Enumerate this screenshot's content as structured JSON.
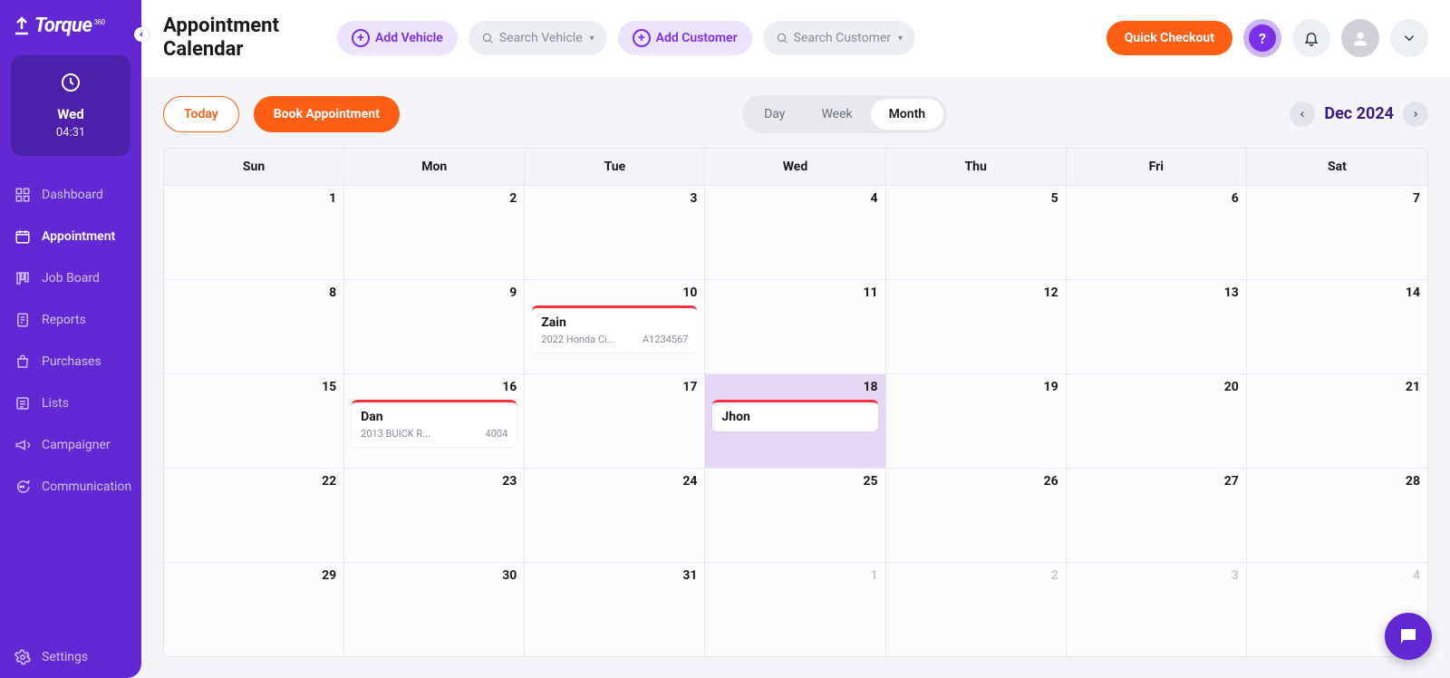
{
  "brand": {
    "name": "Torque",
    "sup": "360"
  },
  "clock": {
    "day": "Wed",
    "time": "04:31"
  },
  "sidebar": {
    "items": [
      {
        "label": "Dashboard"
      },
      {
        "label": "Appointment"
      },
      {
        "label": "Job Board"
      },
      {
        "label": "Reports"
      },
      {
        "label": "Purchases"
      },
      {
        "label": "Lists"
      },
      {
        "label": "Campaigner"
      },
      {
        "label": "Communication"
      }
    ],
    "settings_label": "Settings"
  },
  "header": {
    "title_line1": "Appointment",
    "title_line2": "Calendar",
    "add_vehicle": "Add Vehicle",
    "search_vehicle_placeholder": "Search Vehicle",
    "add_customer": "Add Customer",
    "search_customer_placeholder": "Search Customer",
    "quick_checkout": "Quick Checkout"
  },
  "controls": {
    "today": "Today",
    "book": "Book Appointment",
    "view_day": "Day",
    "view_week": "Week",
    "view_month": "Month",
    "month_label": "Dec 2024"
  },
  "calendar": {
    "dow": [
      "Sun",
      "Mon",
      "Tue",
      "Wed",
      "Thu",
      "Fri",
      "Sat"
    ],
    "cells": [
      {
        "n": "1"
      },
      {
        "n": "2"
      },
      {
        "n": "3"
      },
      {
        "n": "4"
      },
      {
        "n": "5"
      },
      {
        "n": "6"
      },
      {
        "n": "7"
      },
      {
        "n": "8"
      },
      {
        "n": "9"
      },
      {
        "n": "10",
        "events": [
          {
            "name": "Zain",
            "vehicle": "2022 Honda Ci...",
            "code": "A1234567"
          }
        ]
      },
      {
        "n": "11"
      },
      {
        "n": "12"
      },
      {
        "n": "13"
      },
      {
        "n": "14"
      },
      {
        "n": "15"
      },
      {
        "n": "16",
        "events": [
          {
            "name": "Dan",
            "vehicle": "2013 BUICK R...",
            "code": "4004"
          }
        ]
      },
      {
        "n": "17"
      },
      {
        "n": "18",
        "today": true,
        "events": [
          {
            "name": "Jhon"
          }
        ]
      },
      {
        "n": "19"
      },
      {
        "n": "20"
      },
      {
        "n": "21"
      },
      {
        "n": "22"
      },
      {
        "n": "23"
      },
      {
        "n": "24"
      },
      {
        "n": "25"
      },
      {
        "n": "26"
      },
      {
        "n": "27"
      },
      {
        "n": "28"
      },
      {
        "n": "29"
      },
      {
        "n": "30"
      },
      {
        "n": "31"
      },
      {
        "n": "1",
        "other": true
      },
      {
        "n": "2",
        "other": true
      },
      {
        "n": "3",
        "other": true
      },
      {
        "n": "4",
        "other": true
      }
    ]
  }
}
